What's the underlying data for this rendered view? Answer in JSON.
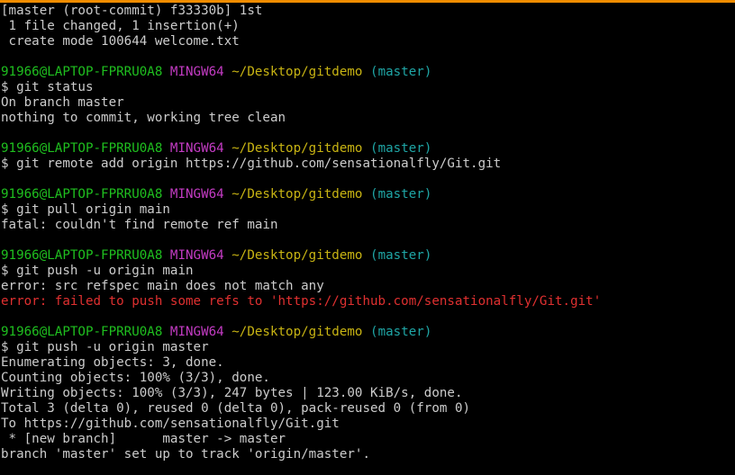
{
  "colors": {
    "background": "#000000",
    "text": "#cccccc",
    "user": "#1fbf1f",
    "env": "#c43cc4",
    "path": "#c8b413",
    "branch": "#1fa6a6",
    "error": "#e03030",
    "title_bar_accent": "#f08c00"
  },
  "lines": [
    {
      "segments": [
        {
          "text": "[master (root-commit) f33330b] 1st",
          "color": "#cccccc"
        }
      ]
    },
    {
      "segments": [
        {
          "text": " 1 file changed, 1 insertion(+)",
          "color": "#cccccc"
        }
      ]
    },
    {
      "segments": [
        {
          "text": " create mode 100644 welcome.txt",
          "color": "#cccccc"
        }
      ]
    },
    {
      "segments": []
    },
    {
      "segments": [
        {
          "text": "91966@LAPTOP-FPRRU0A8",
          "color": "#1fbf1f"
        },
        {
          "text": " ",
          "color": "#cccccc"
        },
        {
          "text": "MINGW64",
          "color": "#c43cc4"
        },
        {
          "text": " ",
          "color": "#cccccc"
        },
        {
          "text": "~/Desktop/gitdemo",
          "color": "#c8b413"
        },
        {
          "text": " ",
          "color": "#cccccc"
        },
        {
          "text": "(master)",
          "color": "#1fa6a6"
        }
      ]
    },
    {
      "segments": [
        {
          "text": "$ git status",
          "color": "#cccccc"
        }
      ]
    },
    {
      "segments": [
        {
          "text": "On branch master",
          "color": "#cccccc"
        }
      ]
    },
    {
      "segments": [
        {
          "text": "nothing to commit, working tree clean",
          "color": "#cccccc"
        }
      ]
    },
    {
      "segments": []
    },
    {
      "segments": [
        {
          "text": "91966@LAPTOP-FPRRU0A8",
          "color": "#1fbf1f"
        },
        {
          "text": " ",
          "color": "#cccccc"
        },
        {
          "text": "MINGW64",
          "color": "#c43cc4"
        },
        {
          "text": " ",
          "color": "#cccccc"
        },
        {
          "text": "~/Desktop/gitdemo",
          "color": "#c8b413"
        },
        {
          "text": " ",
          "color": "#cccccc"
        },
        {
          "text": "(master)",
          "color": "#1fa6a6"
        }
      ]
    },
    {
      "segments": [
        {
          "text": "$ git remote add origin https://github.com/sensationalfly/Git.git",
          "color": "#cccccc"
        }
      ]
    },
    {
      "segments": []
    },
    {
      "segments": [
        {
          "text": "91966@LAPTOP-FPRRU0A8",
          "color": "#1fbf1f"
        },
        {
          "text": " ",
          "color": "#cccccc"
        },
        {
          "text": "MINGW64",
          "color": "#c43cc4"
        },
        {
          "text": " ",
          "color": "#cccccc"
        },
        {
          "text": "~/Desktop/gitdemo",
          "color": "#c8b413"
        },
        {
          "text": " ",
          "color": "#cccccc"
        },
        {
          "text": "(master)",
          "color": "#1fa6a6"
        }
      ]
    },
    {
      "segments": [
        {
          "text": "$ git pull origin main",
          "color": "#cccccc"
        }
      ]
    },
    {
      "segments": [
        {
          "text": "fatal: couldn't find remote ref main",
          "color": "#cccccc"
        }
      ]
    },
    {
      "segments": []
    },
    {
      "segments": [
        {
          "text": "91966@LAPTOP-FPRRU0A8",
          "color": "#1fbf1f"
        },
        {
          "text": " ",
          "color": "#cccccc"
        },
        {
          "text": "MINGW64",
          "color": "#c43cc4"
        },
        {
          "text": " ",
          "color": "#cccccc"
        },
        {
          "text": "~/Desktop/gitdemo",
          "color": "#c8b413"
        },
        {
          "text": " ",
          "color": "#cccccc"
        },
        {
          "text": "(master)",
          "color": "#1fa6a6"
        }
      ]
    },
    {
      "segments": [
        {
          "text": "$ git push -u origin main",
          "color": "#cccccc"
        }
      ]
    },
    {
      "segments": [
        {
          "text": "error: src refspec main does not match any",
          "color": "#cccccc"
        }
      ]
    },
    {
      "segments": [
        {
          "text": "error: failed to push some refs to 'https://github.com/sensationalfly/Git.git'",
          "color": "#e03030"
        }
      ]
    },
    {
      "segments": []
    },
    {
      "segments": [
        {
          "text": "91966@LAPTOP-FPRRU0A8",
          "color": "#1fbf1f"
        },
        {
          "text": " ",
          "color": "#cccccc"
        },
        {
          "text": "MINGW64",
          "color": "#c43cc4"
        },
        {
          "text": " ",
          "color": "#cccccc"
        },
        {
          "text": "~/Desktop/gitdemo",
          "color": "#c8b413"
        },
        {
          "text": " ",
          "color": "#cccccc"
        },
        {
          "text": "(master)",
          "color": "#1fa6a6"
        }
      ]
    },
    {
      "segments": [
        {
          "text": "$ git push -u origin master",
          "color": "#cccccc"
        }
      ]
    },
    {
      "segments": [
        {
          "text": "Enumerating objects: 3, done.",
          "color": "#cccccc"
        }
      ]
    },
    {
      "segments": [
        {
          "text": "Counting objects: 100% (3/3), done.",
          "color": "#cccccc"
        }
      ]
    },
    {
      "segments": [
        {
          "text": "Writing objects: 100% (3/3), 247 bytes | 123.00 KiB/s, done.",
          "color": "#cccccc"
        }
      ]
    },
    {
      "segments": [
        {
          "text": "Total 3 (delta 0), reused 0 (delta 0), pack-reused 0 (from 0)",
          "color": "#cccccc"
        }
      ]
    },
    {
      "segments": [
        {
          "text": "To https://github.com/sensationalfly/Git.git",
          "color": "#cccccc"
        }
      ]
    },
    {
      "segments": [
        {
          "text": " * [new branch]      master -> master",
          "color": "#cccccc"
        }
      ]
    },
    {
      "segments": [
        {
          "text": "branch 'master' set up to track 'origin/master'.",
          "color": "#cccccc"
        }
      ]
    }
  ]
}
